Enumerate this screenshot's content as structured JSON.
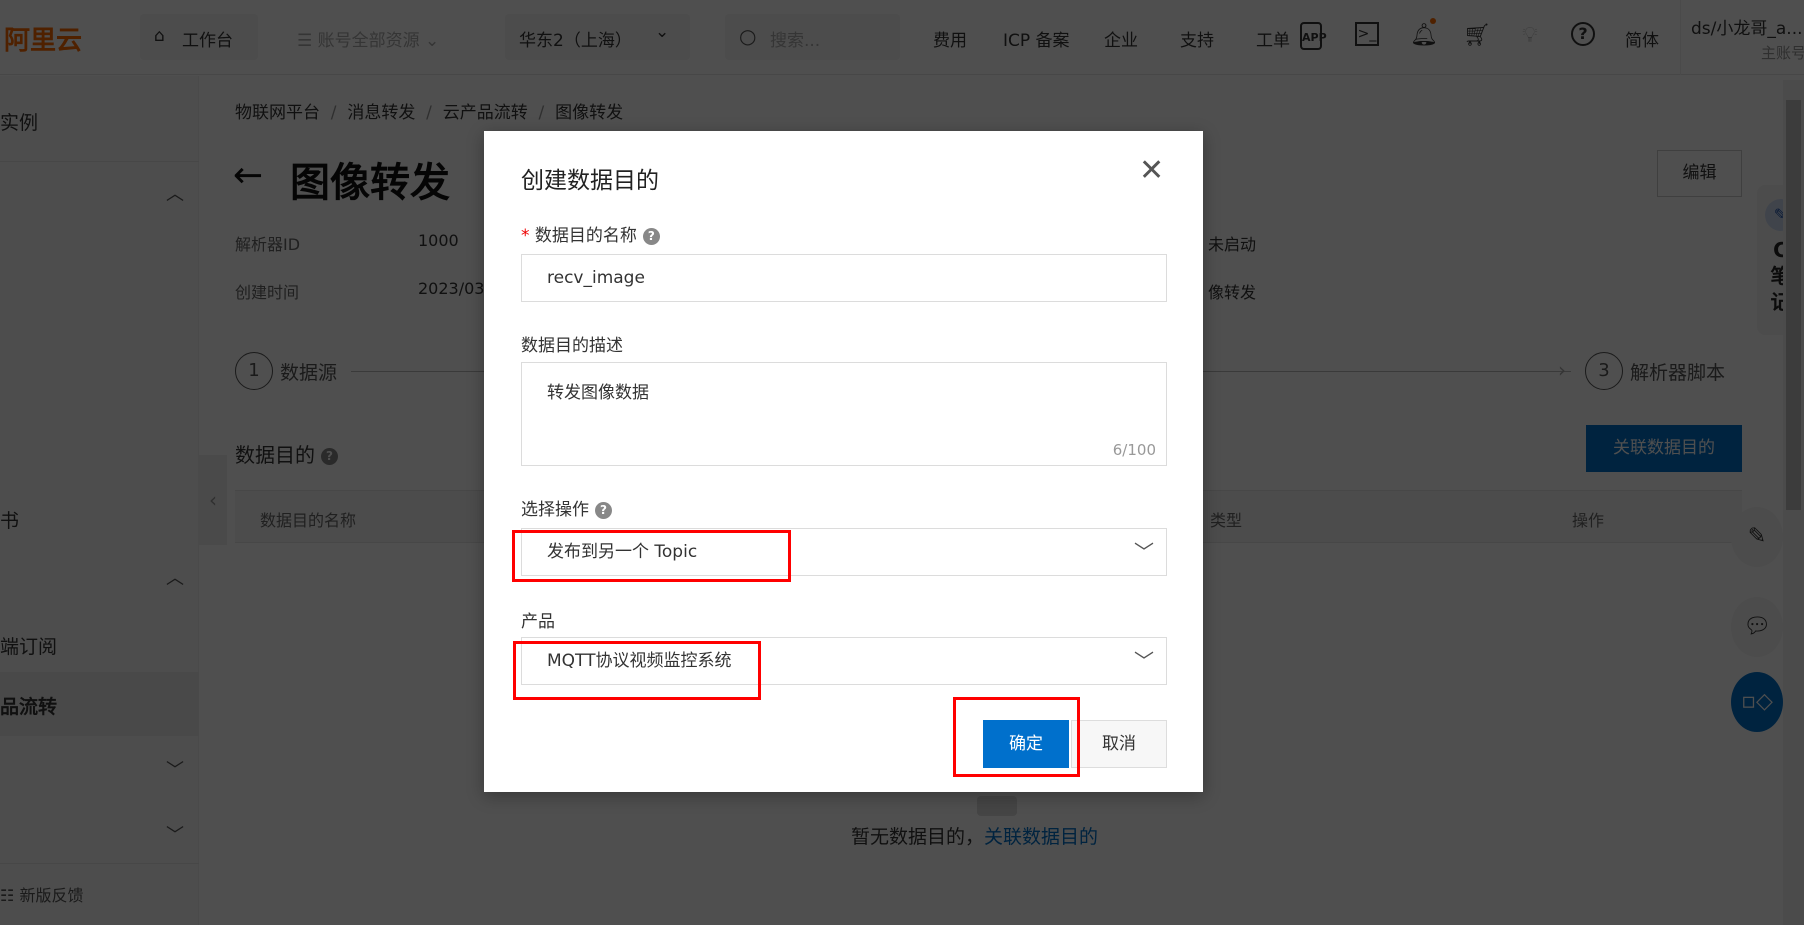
{
  "topbar": {
    "logo": "阿里云",
    "workbench": "工作台",
    "resources": "账号全部资源",
    "region": "华东2（上海）",
    "search_placeholder": "搜索...",
    "links": [
      "费用",
      "ICP 备案",
      "企业",
      "支持",
      "工单"
    ],
    "icons": [
      "app-icon",
      "terminal-icon",
      "bell-icon",
      "cart-icon",
      "bulb-icon",
      "help-icon"
    ],
    "language": "简体",
    "user": "ds/小龙哥_a...",
    "account_type": "主账号"
  },
  "sidebar": {
    "items": [
      "实例",
      "书",
      "端订阅",
      "品流转"
    ],
    "selected": "品流转",
    "feedback": "新版反馈"
  },
  "page": {
    "breadcrumb": [
      "物联网平台",
      "消息转发",
      "云产品流转",
      "图像转发"
    ],
    "title": "图像转发",
    "edit_button": "编辑",
    "parser_id_label": "解析器ID",
    "parser_id": "1000",
    "created_label": "创建时间",
    "created": "2023/03",
    "status": "未启动",
    "desc_partial": "像转发",
    "steps": [
      {
        "num": "1",
        "label": "数据源"
      },
      {
        "num": "3",
        "label": "解析器脚本"
      }
    ],
    "section_title": "数据目的",
    "associate_button": "关联数据目的",
    "table_headers": [
      "数据目的名称",
      "类型",
      "操作"
    ],
    "empty_text": "暂无数据目的，",
    "empty_link": "关联数据目的"
  },
  "right_float": {
    "notes_tab": "C\n笔\n记"
  },
  "modal": {
    "title": "创建数据目的",
    "name_label": "数据目的名称",
    "name_value": "recv_image",
    "desc_label": "数据目的描述",
    "desc_value": "转发图像数据",
    "desc_counter": "6/100",
    "operation_label": "选择操作",
    "operation_value": "发布到另一个 Topic",
    "product_label": "产品",
    "product_value": "MQTT协议视频监控系统",
    "confirm": "确定",
    "cancel": "取消"
  },
  "colors": {
    "primary": "#0070cc",
    "brand": "#ff6a00",
    "highlight": "#ff0000"
  }
}
